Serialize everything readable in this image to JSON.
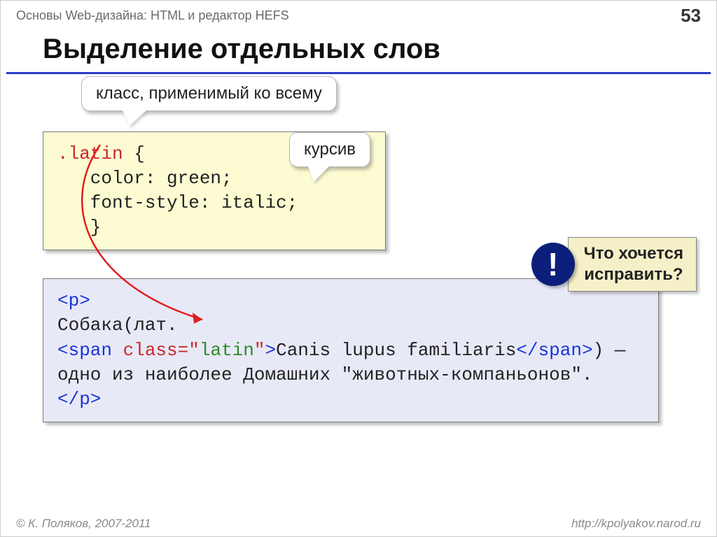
{
  "header": {
    "course": "Основы Web-дизайна: HTML и редактор HEFS",
    "page": "53"
  },
  "title": "Выделение отдельных слов",
  "callouts": {
    "class_note": "класс, применимый ко всему",
    "italic_note": "курсив"
  },
  "css_block": {
    "selector": ".latin",
    "open": " {",
    "rule1": "   color: green;",
    "rule2": "   font-style: italic;",
    "close": "   }"
  },
  "alert": {
    "bang": "!",
    "line1": "Что хочется",
    "line2": "исправить?"
  },
  "html_block": {
    "l1": "<p>",
    "l2": "Собака(лат.",
    "span_open_tag": "<span ",
    "span_class_attr": "class=",
    "span_class_q1": "\"",
    "span_class_val": "latin",
    "span_class_q2": "\"",
    "span_open_end": ">",
    "latin_text": "Canis lupus familiaris",
    "span_close": "</span>",
    "rest": ") — одно из наиболее Домашних \"животных-компаньонов\".",
    "l_end": "</p>"
  },
  "footer": {
    "left": "© К. Поляков, 2007-2011",
    "right": "http://kpolyakov.narod.ru"
  }
}
